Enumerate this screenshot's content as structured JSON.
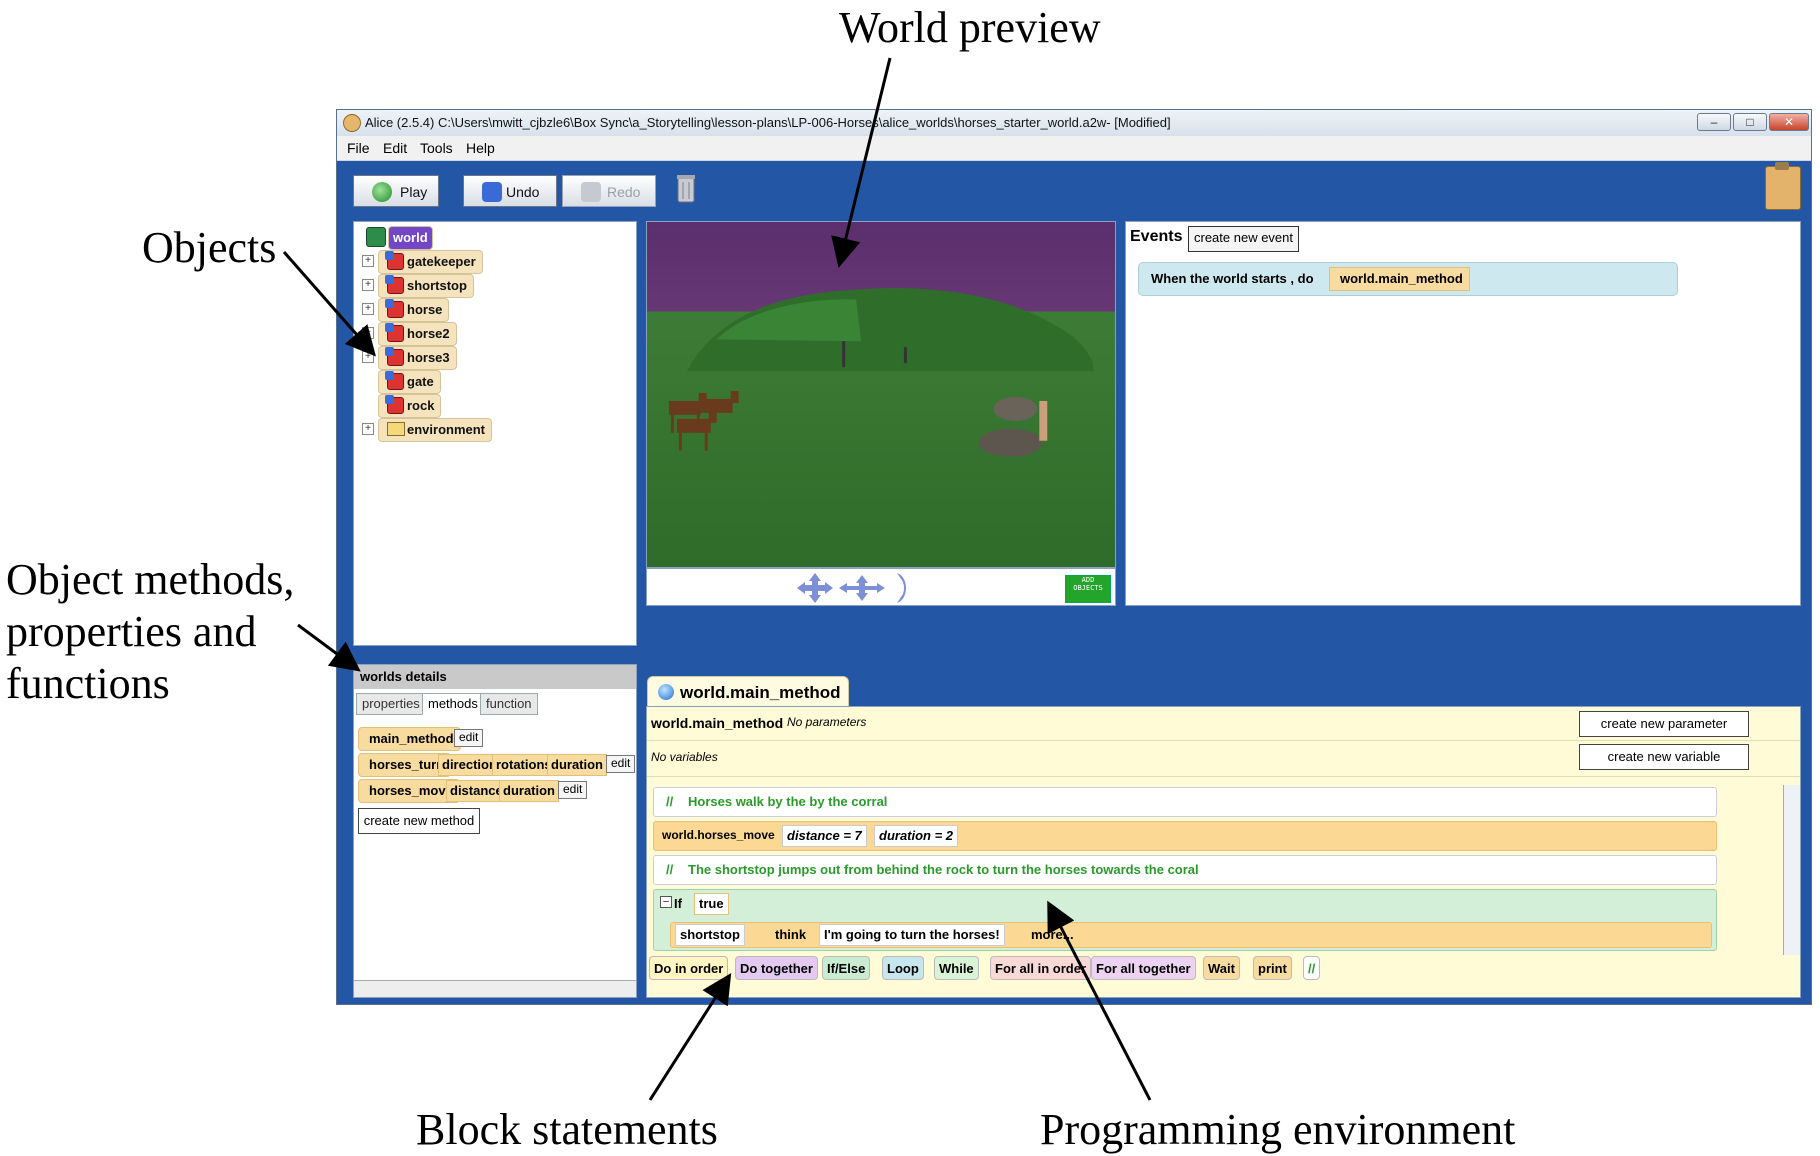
{
  "callouts": {
    "world_preview": "World preview",
    "objects": "Objects",
    "object_methods_1": "Object methods,",
    "object_methods_2": "properties and",
    "object_methods_3": "functions",
    "block_statements": "Block statements",
    "programming_environment": "Programming environment"
  },
  "window": {
    "title": "Alice (2.5.4) C:\\Users\\mwitt_cjbzle6\\Box Sync\\a_Storytelling\\lesson-plans\\LP-006-Horses\\alice_worlds\\horses_starter_world.a2w-  [Modified]",
    "menu": [
      "File",
      "Edit",
      "Tools",
      "Help"
    ]
  },
  "toolbar": {
    "play": "Play",
    "undo": "Undo",
    "redo": "Redo"
  },
  "objects": {
    "root": "world",
    "items": [
      "gatekeeper",
      "shortstop",
      "horse",
      "horse2",
      "horse3",
      "gate",
      "rock",
      "environment"
    ]
  },
  "details": {
    "header": "worlds details",
    "tabs": [
      "properties",
      "methods",
      "function"
    ],
    "methods": [
      {
        "name": "main_method",
        "params": []
      },
      {
        "name": "horses_turn",
        "params": [
          "direction",
          "rotations",
          "duration"
        ]
      },
      {
        "name": "horses_move",
        "params": [
          "distance",
          "duration"
        ]
      }
    ],
    "edit_label": "edit",
    "create_method": "create new method"
  },
  "preview": {
    "add_objects": "ADD OBJECTS"
  },
  "events": {
    "title": "Events",
    "create_event": "create new event",
    "event_text": "When the world starts , do",
    "event_method": "world.main_method"
  },
  "editor": {
    "tab": "world.main_method",
    "method_name": "world.main_method",
    "no_params": "No parameters",
    "no_vars": "No variables",
    "create_param": "create new parameter",
    "create_var": "create new variable",
    "comment_marker": "//",
    "comment1": "Horses walk by the by the corral",
    "move_call": "world.horses_move",
    "move_distance": "distance = 7",
    "move_duration": "duration = 2",
    "comment2": "The shortstop jumps out from behind the rock to turn the horses towards the coral",
    "if_label": "If",
    "if_cond": "true",
    "think_obj": "shortstop",
    "think_verb": "think",
    "think_text": "I'm going to turn the horses!",
    "more": "more..."
  },
  "blocks": [
    "Do in order",
    "Do together",
    "If/Else",
    "Loop",
    "While",
    "For all in order",
    "For all together",
    "Wait",
    "print",
    "//"
  ],
  "colors": {
    "window_blue": "#2456a6",
    "world_highlight": "#7246c6",
    "method_tile": "#f8dc9f",
    "event_bg": "#cde8ee",
    "editor_bg": "#fffbd7"
  }
}
